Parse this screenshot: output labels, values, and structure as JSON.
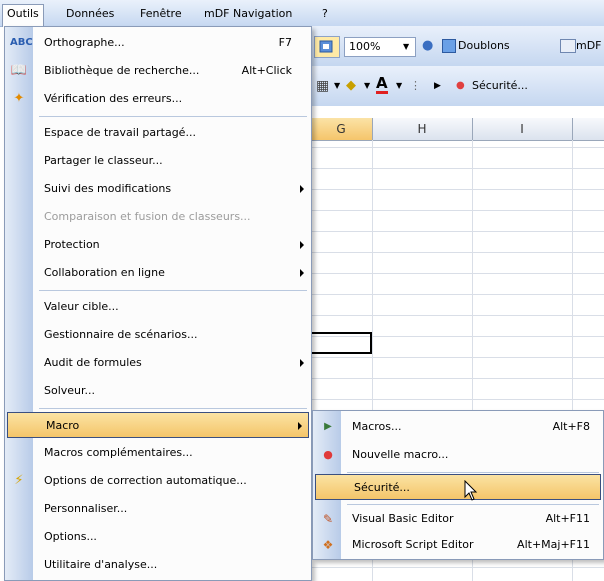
{
  "menubar": {
    "items": [
      "Outils",
      "Données",
      "Fenêtre",
      "mDF Navigation",
      "?"
    ]
  },
  "toolbar": {
    "zoom": "100%",
    "doublons": "Doublons",
    "mdf": "mDF",
    "securite": "Sécurité..."
  },
  "columns": [
    "G",
    "H",
    "I"
  ],
  "menu": {
    "items": [
      {
        "label": "Orthographe...",
        "shortcut": "F7",
        "icon": "spelling-icon"
      },
      {
        "label": "Bibliothèque de recherche...",
        "shortcut": "Alt+Click",
        "icon": "research-icon"
      },
      {
        "label": "Vérification des erreurs...",
        "shortcut": "",
        "icon": "error-check-icon"
      },
      {
        "label": "Espace de travail partagé...",
        "shortcut": ""
      },
      {
        "label": "Partager le classeur...",
        "shortcut": ""
      },
      {
        "label": "Suivi des modifications",
        "shortcut": "",
        "submenu": true
      },
      {
        "label": "Comparaison et fusion de classeurs...",
        "shortcut": "",
        "disabled": true
      },
      {
        "label": "Protection",
        "shortcut": "",
        "submenu": true
      },
      {
        "label": "Collaboration en ligne",
        "shortcut": "",
        "submenu": true
      },
      {
        "label": "Valeur cible...",
        "shortcut": ""
      },
      {
        "label": "Gestionnaire de scénarios...",
        "shortcut": ""
      },
      {
        "label": "Audit de formules",
        "shortcut": "",
        "submenu": true
      },
      {
        "label": "Solveur...",
        "shortcut": ""
      },
      {
        "label": "Macro",
        "shortcut": "",
        "submenu": true,
        "highlighted": true
      },
      {
        "label": "Macros complémentaires...",
        "shortcut": ""
      },
      {
        "label": "Options de correction automatique...",
        "shortcut": "",
        "icon": "autocorrect-icon"
      },
      {
        "label": "Personnaliser...",
        "shortcut": ""
      },
      {
        "label": "Options...",
        "shortcut": ""
      },
      {
        "label": "Utilitaire d'analyse...",
        "shortcut": ""
      }
    ]
  },
  "submenu": {
    "items": [
      {
        "label": "Macros...",
        "shortcut": "Alt+F8",
        "icon": "play-macro-icon"
      },
      {
        "label": "Nouvelle macro...",
        "shortcut": "",
        "icon": "record-macro-icon"
      },
      {
        "label": "Sécurité...",
        "shortcut": "",
        "highlighted": true
      },
      {
        "label": "Visual Basic Editor",
        "shortcut": "Alt+F11",
        "icon": "vba-editor-icon"
      },
      {
        "label": "Microsoft Script Editor",
        "shortcut": "Alt+Maj+F11",
        "icon": "script-editor-icon"
      }
    ]
  },
  "colors": {
    "highlight": "#f4c56a",
    "highlight_border": "#3a4f80",
    "gutter": "#b8cbe8",
    "toolbar": "#c5d7f0"
  }
}
